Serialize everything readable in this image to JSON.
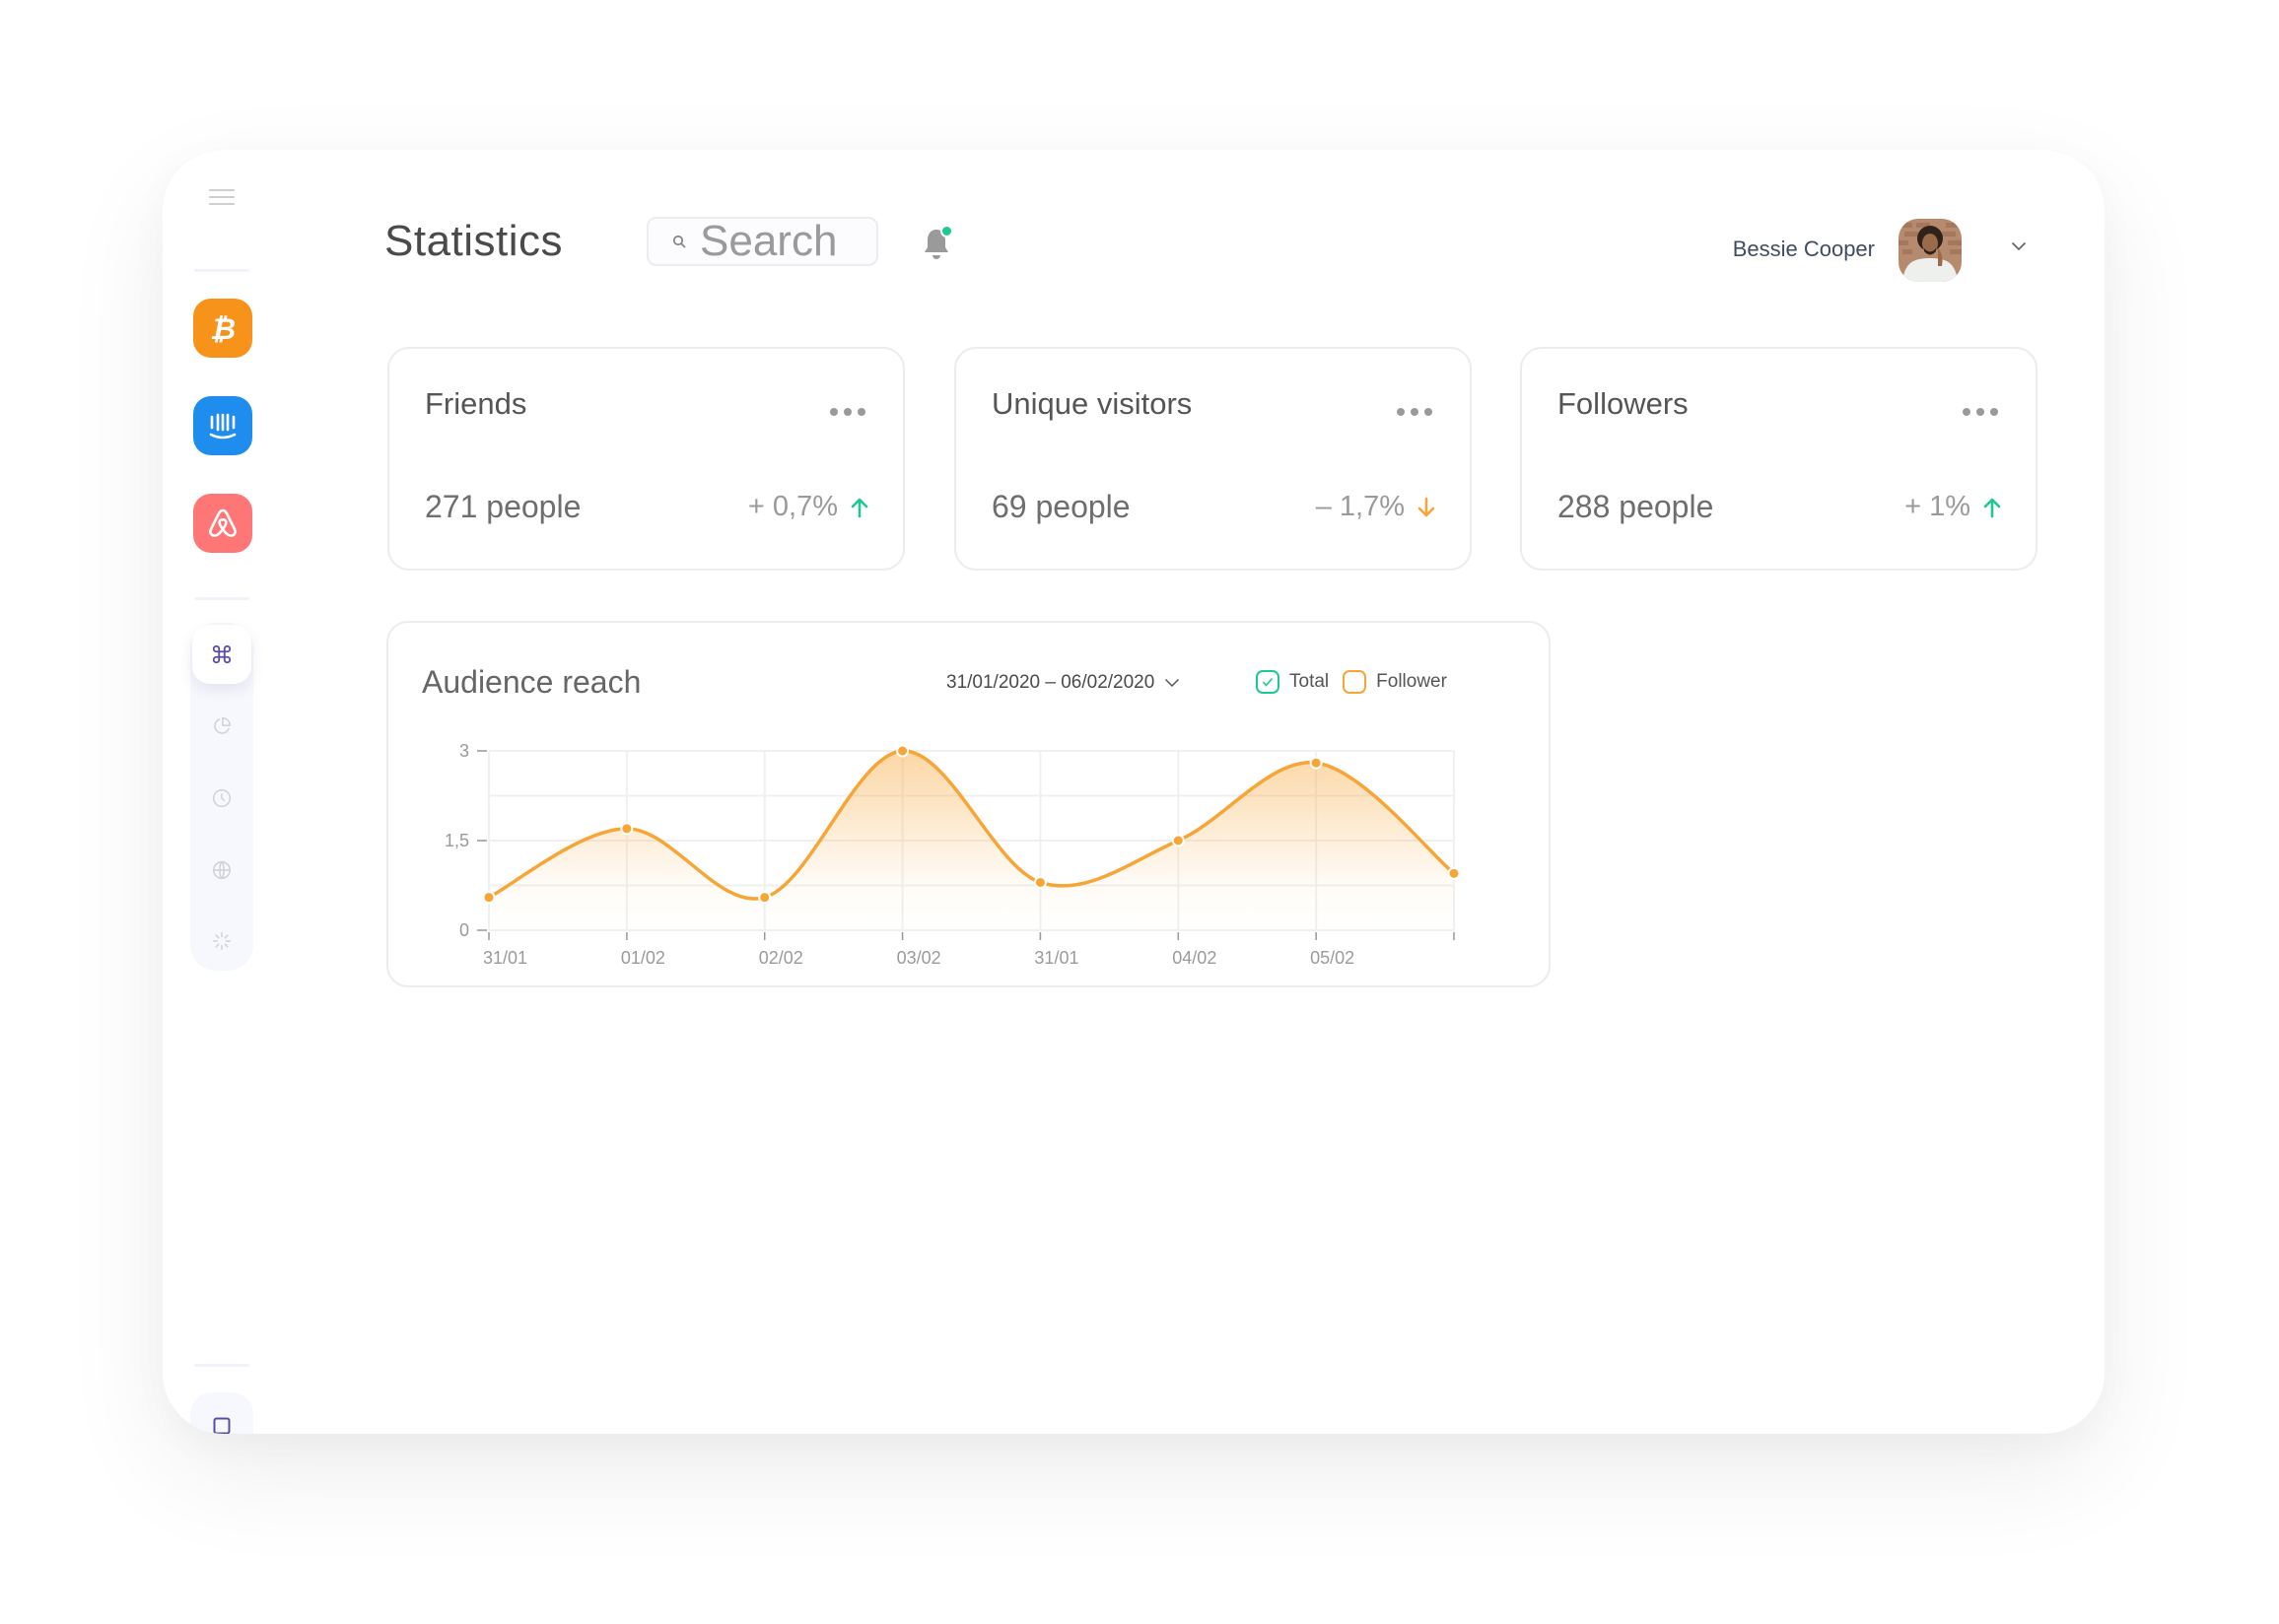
{
  "header": {
    "title": "Statistics",
    "search_placeholder": "Search",
    "notification_has_unread": true,
    "user_name": "Bessie Cooper"
  },
  "sidebar": {
    "menu_icon": "hamburger-icon",
    "apps": [
      {
        "name": "bitcoin",
        "icon": "bitcoin-icon",
        "color": "#F7931A"
      },
      {
        "name": "intercom",
        "icon": "intercom-icon",
        "color": "#1F8DED"
      },
      {
        "name": "airbnb",
        "icon": "airbnb-icon",
        "color": "#FF7677"
      }
    ],
    "nav": [
      {
        "name": "command",
        "icon": "command-icon",
        "active": true
      },
      {
        "name": "statistics",
        "icon": "pie-chart-icon",
        "active": false
      },
      {
        "name": "history",
        "icon": "clock-icon",
        "active": false
      },
      {
        "name": "global",
        "icon": "globe-icon",
        "active": false
      },
      {
        "name": "loading",
        "icon": "loader-icon",
        "active": false
      }
    ],
    "bottom_icon": "square-icon"
  },
  "stats": [
    {
      "title": "Friends",
      "value": "271 people",
      "change": "+ 0,7%",
      "direction": "up",
      "color": "#1EC98F"
    },
    {
      "title": "Unique visitors",
      "value": "69 people",
      "change": "– 1,7%",
      "direction": "down",
      "color": "#F7A536"
    },
    {
      "title": "Followers",
      "value": "288 people",
      "change": "+ 1%",
      "direction": "up",
      "color": "#1EC98F"
    }
  ],
  "audience": {
    "title": "Audience reach",
    "date_range": "31/01/2020 – 06/02/2020",
    "legend": [
      {
        "label": "Total",
        "checked": true,
        "color": "#1EC98F"
      },
      {
        "label": "Follower",
        "checked": false,
        "color": "#F7A536"
      }
    ]
  },
  "chart_data": {
    "type": "area",
    "title": "Audience reach",
    "xlabel": "",
    "ylabel": "",
    "categories": [
      "31/01",
      "01/02",
      "02/02",
      "03/02",
      "31/01",
      "04/02",
      "05/02",
      ""
    ],
    "series": [
      {
        "name": "Follower",
        "color": "#F7A536",
        "values": [
          0.55,
          1.7,
          0.55,
          3.0,
          0.8,
          1.5,
          2.8,
          0.95
        ]
      }
    ],
    "yticks": [
      "0",
      "1,5",
      "3"
    ],
    "ytick_values": [
      0,
      1.5,
      3
    ],
    "ylim": [
      0,
      3
    ],
    "grid": true,
    "legend_position": "top-right"
  }
}
